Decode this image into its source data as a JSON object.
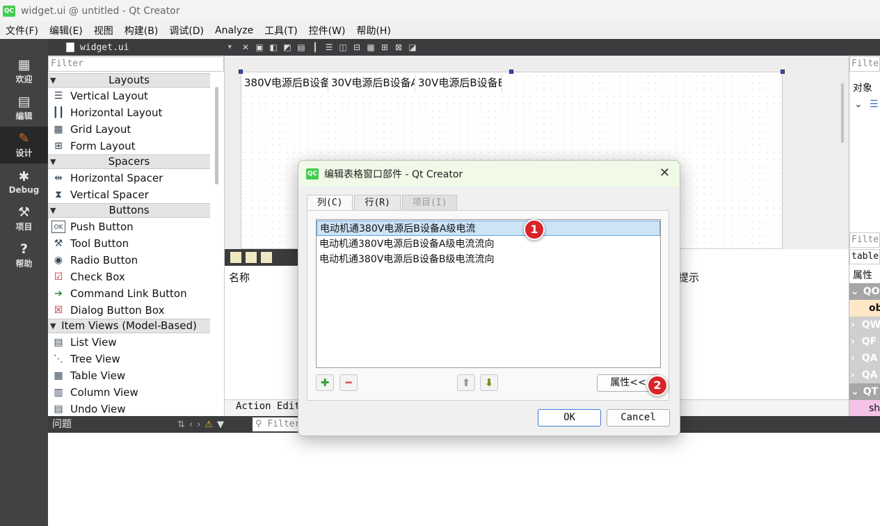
{
  "window": {
    "title": "widget.ui @ untitled - Qt Creator",
    "logo": "QC"
  },
  "menubar": [
    "文件(F)",
    "编辑(E)",
    "视图",
    "构建(B)",
    "调试(D)",
    "Analyze",
    "工具(T)",
    "控件(W)",
    "帮助(H)"
  ],
  "modes": [
    {
      "label": "欢迎",
      "icon": "grid-icon"
    },
    {
      "label": "编辑",
      "icon": "edit-doc-icon"
    },
    {
      "label": "设计",
      "icon": "pencil-icon"
    },
    {
      "label": "Debug",
      "icon": "bug-icon"
    },
    {
      "label": "项目",
      "icon": "wrench-icon"
    },
    {
      "label": "帮助",
      "icon": "help-icon"
    }
  ],
  "editor": {
    "file": "widget.ui"
  },
  "widgetbox": {
    "filter_placeholder": "Filter",
    "categories": {
      "layouts": "Layouts",
      "spacers": "Spacers",
      "buttons": "Buttons",
      "item_views": "Item Views (Model-Based)"
    },
    "items": {
      "vertical_layout": "Vertical Layout",
      "horizontal_layout": "Horizontal Layout",
      "grid_layout": "Grid Layout",
      "form_layout": "Form Layout",
      "horizontal_spacer": "Horizontal Spacer",
      "vertical_spacer": "Vertical Spacer",
      "push_button": "Push Button",
      "tool_button": "Tool Button",
      "radio_button": "Radio Button",
      "check_box": "Check Box",
      "command_link_button": "Command Link Button",
      "dialog_button_box": "Dialog Button Box",
      "list_view": "List View",
      "tree_view": "Tree View",
      "table_view": "Table View",
      "column_view": "Column View",
      "undo_view": "Undo View"
    }
  },
  "form": {
    "headers": [
      "380V电源后B设备",
      "30V电源后B设备A",
      "30V电源后B设备B"
    ]
  },
  "right_panel": {
    "filter_placeholder": "Filter",
    "object_label": "对象",
    "filter2_placeholder": "Filter",
    "object_name": "table",
    "property_label": "属性",
    "rows": [
      "QO",
      "ob",
      "QW",
      "QF",
      "QA",
      "QA",
      "QT",
      "sh"
    ]
  },
  "action_editor": {
    "col_name": "名称",
    "col_tip": "提示",
    "tab": "Action Edit"
  },
  "issues": {
    "label": "问题",
    "filter_placeholder": "Filter"
  },
  "dialog": {
    "title": "编辑表格窗口部件 - Qt Creator",
    "tabs": [
      "列(C)",
      "行(R)",
      "项目(I)"
    ],
    "items": [
      "电动机通380V电源后B设备A级电流",
      "电动机通380V电源后B设备A级电流流向",
      "电动机通380V电源后B设备B级电流流向"
    ],
    "properties_button": "属性<<",
    "ok": "OK",
    "cancel": "Cancel",
    "badges": [
      "1",
      "2"
    ]
  }
}
